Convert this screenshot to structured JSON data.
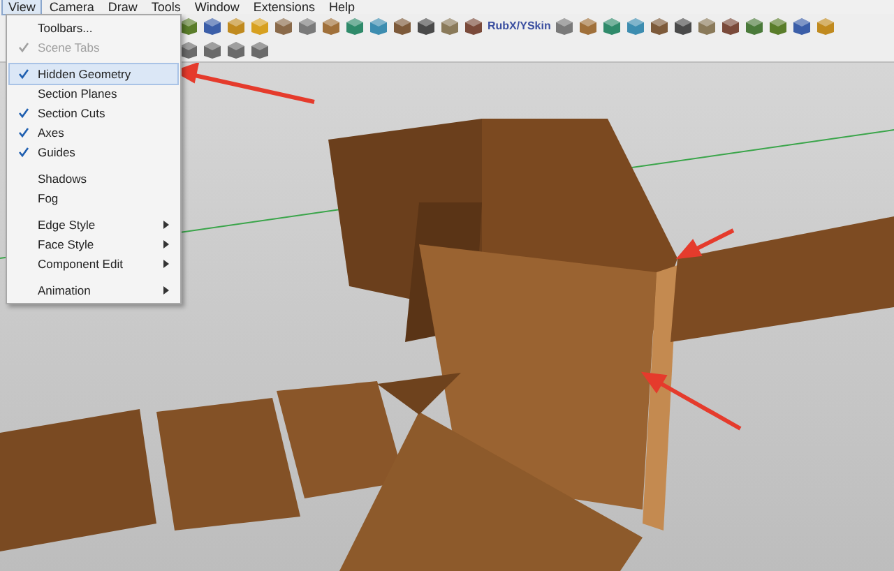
{
  "menu_bar": {
    "items": [
      {
        "label": "View",
        "selected": true
      },
      {
        "label": "Camera",
        "selected": false
      },
      {
        "label": "Draw",
        "selected": false
      },
      {
        "label": "Tools",
        "selected": false
      },
      {
        "label": "Window",
        "selected": false
      },
      {
        "label": "Extensions",
        "selected": false
      },
      {
        "label": "Help",
        "selected": false
      }
    ]
  },
  "view_menu": {
    "items": [
      {
        "kind": "item",
        "label": "Toolbars...",
        "checked": false,
        "disabled": false,
        "selected": false,
        "submenu": false
      },
      {
        "kind": "item",
        "label": "Scene Tabs",
        "checked": true,
        "disabled": true,
        "selected": false,
        "submenu": false
      },
      {
        "kind": "separator"
      },
      {
        "kind": "item",
        "label": "Hidden Geometry",
        "checked": true,
        "disabled": false,
        "selected": true,
        "submenu": false
      },
      {
        "kind": "item",
        "label": "Section Planes",
        "checked": false,
        "disabled": false,
        "selected": false,
        "submenu": false
      },
      {
        "kind": "item",
        "label": "Section Cuts",
        "checked": true,
        "disabled": false,
        "selected": false,
        "submenu": false
      },
      {
        "kind": "item",
        "label": "Axes",
        "checked": true,
        "disabled": false,
        "selected": false,
        "submenu": false
      },
      {
        "kind": "item",
        "label": "Guides",
        "checked": true,
        "disabled": false,
        "selected": false,
        "submenu": false
      },
      {
        "kind": "separator"
      },
      {
        "kind": "item",
        "label": "Shadows",
        "checked": false,
        "disabled": false,
        "selected": false,
        "submenu": false
      },
      {
        "kind": "item",
        "label": "Fog",
        "checked": false,
        "disabled": false,
        "selected": false,
        "submenu": false
      },
      {
        "kind": "separator"
      },
      {
        "kind": "item",
        "label": "Edge Style",
        "checked": false,
        "disabled": false,
        "selected": false,
        "submenu": true
      },
      {
        "kind": "item",
        "label": "Face Style",
        "checked": false,
        "disabled": false,
        "selected": false,
        "submenu": true
      },
      {
        "kind": "item",
        "label": "Component Edit",
        "checked": false,
        "disabled": false,
        "selected": false,
        "submenu": true
      },
      {
        "kind": "separator"
      },
      {
        "kind": "item",
        "label": "Animation",
        "checked": false,
        "disabled": false,
        "selected": false,
        "submenu": true
      }
    ]
  },
  "toolbar": {
    "label": "RubX/YSkin"
  }
}
